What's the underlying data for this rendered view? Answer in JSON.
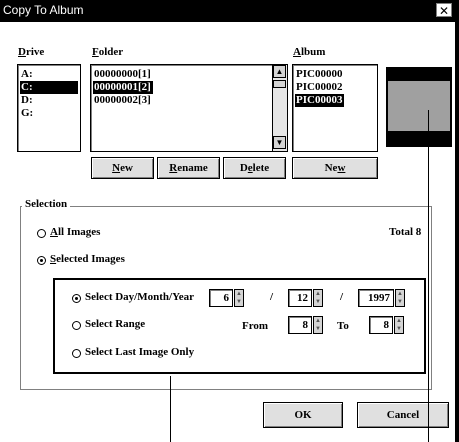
{
  "window": {
    "title": "Copy To Album",
    "close_glyph": "✕"
  },
  "drive": {
    "label_prefix": "D",
    "label_rest": "rive",
    "items": [
      {
        "label": "A:",
        "selected": false
      },
      {
        "label": "C:",
        "selected": true
      },
      {
        "label": "D:",
        "selected": false
      },
      {
        "label": "G:",
        "selected": false
      }
    ]
  },
  "folder": {
    "label_prefix": "F",
    "label_rest": "older",
    "items": [
      {
        "label": "00000000[1]",
        "selected": false
      },
      {
        "label": "00000001[2]",
        "selected": true
      },
      {
        "label": "00000002[3]",
        "selected": false
      }
    ],
    "buttons": {
      "new_prefix": "N",
      "new_rest": "ew",
      "rename_prefix": "R",
      "rename_rest": "ename",
      "delete_a": "D",
      "delete_ul": "e",
      "delete_rest": "lete"
    }
  },
  "album": {
    "label_prefix": "A",
    "label_rest": "lbum",
    "items": [
      {
        "label": "PIC00000",
        "selected": false
      },
      {
        "label": "PIC00002",
        "selected": false
      },
      {
        "label": "PIC00003",
        "selected": true
      }
    ],
    "new_a": "Ne",
    "new_ul": "w"
  },
  "selection": {
    "label": "Selection",
    "all_ul": "A",
    "all_rest": "ll Images",
    "selected_ul": "S",
    "selected_rest": "elected Images",
    "total": "Total 8",
    "mode": "selected"
  },
  "range": {
    "day_label": "Select Day/Month/Year",
    "day": "6",
    "month": "12",
    "year": "1997",
    "separator": "/",
    "range_label": "Select Range",
    "from_label": "From",
    "from_value": "8",
    "to_label": "To",
    "to_value": "8",
    "last_label": "Select Last Image Only",
    "mode": "day"
  },
  "footer": {
    "ok": "OK",
    "cancel": "Cancel"
  },
  "colors": {
    "preview": "#a0a0a0",
    "selection": "#000000"
  },
  "icons": {
    "scroll_up": "▲",
    "scroll_down": "▼",
    "spin_up": "▲",
    "spin_down": "▼"
  }
}
